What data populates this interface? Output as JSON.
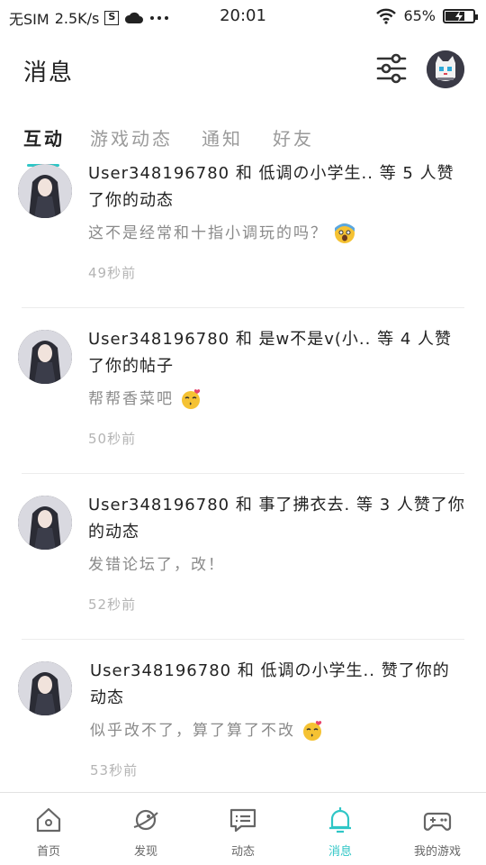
{
  "status_bar": {
    "carrier": "无SIM",
    "speed": "2.5K/s",
    "sim_icon_text": "S",
    "time": "20:01",
    "battery": "65%",
    "battery_level": 0.65
  },
  "header": {
    "title": "消息"
  },
  "tabs": [
    {
      "label": "互动",
      "active": true
    },
    {
      "label": "游戏动态",
      "active": false
    },
    {
      "label": "通知",
      "active": false
    },
    {
      "label": "好友",
      "active": false
    }
  ],
  "messages": [
    {
      "title": "User348196780 和 低调の小学生.. 等 5 人赞了你的动态",
      "comment": "这不是经常和十指小调玩的吗？",
      "emoji": "shocked-face-emoji",
      "time": "49秒前"
    },
    {
      "title": "User348196780 和 是w不是v(小.. 等 4 人赞了你的帖子",
      "comment": "帮帮香菜吧",
      "emoji": "kissing-face-emoji",
      "time": "50秒前"
    },
    {
      "title": "User348196780 和 事了拂衣去. 等 3 人赞了你的动态",
      "comment": "发错论坛了，改！",
      "emoji": "",
      "time": "52秒前"
    },
    {
      "title": "User348196780 和 低调の小学生.. 赞了你的动态",
      "comment": "似乎改不了，算了算了不改",
      "emoji": "kissing-face-emoji",
      "time": "53秒前"
    }
  ],
  "bottom_nav": [
    {
      "label": "首页",
      "icon": "home-icon",
      "active": false
    },
    {
      "label": "发现",
      "icon": "discover-planet-icon",
      "active": false
    },
    {
      "label": "动态",
      "icon": "chat-bubble-icon",
      "active": false
    },
    {
      "label": "消息",
      "icon": "bell-icon",
      "active": true
    },
    {
      "label": "我的游戏",
      "icon": "gamepad-icon",
      "active": false
    }
  ],
  "colors": {
    "accent": "#2fc6c6",
    "text": "#222222",
    "muted": "#8a8a8a",
    "time": "#b4b4b4"
  }
}
